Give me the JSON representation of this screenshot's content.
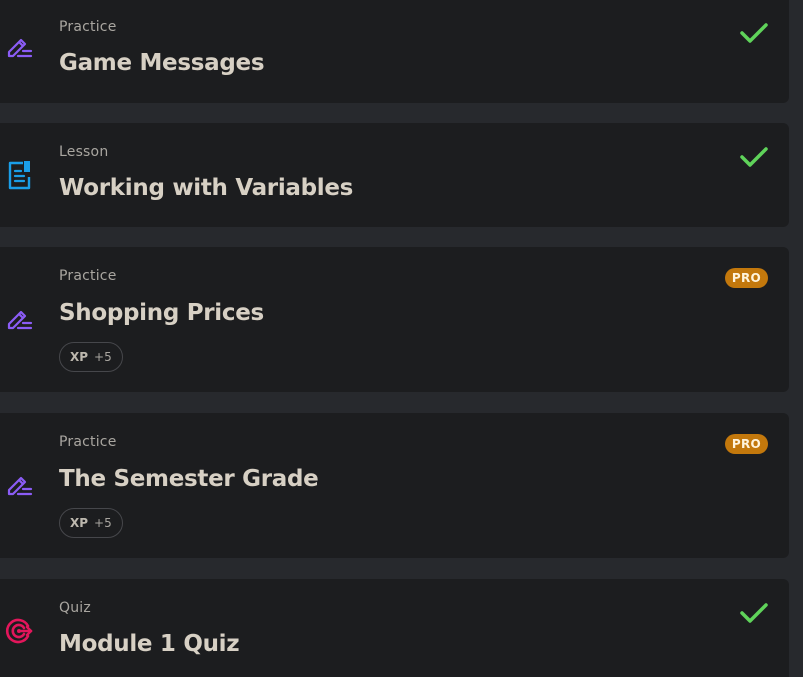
{
  "items": [
    {
      "type": "Practice",
      "title": "Game Messages",
      "status": "completed",
      "icon": "pencil-lines-icon"
    },
    {
      "type": "Lesson",
      "title": "Working with Variables",
      "status": "completed",
      "icon": "document-icon"
    },
    {
      "type": "Practice",
      "title": "Shopping Prices",
      "status": "pro",
      "badge": "PRO",
      "xp_label": "XP",
      "xp_value": "+5",
      "icon": "pencil-lines-icon"
    },
    {
      "type": "Practice",
      "title": "The Semester Grade",
      "status": "pro",
      "badge": "PRO",
      "xp_label": "XP",
      "xp_value": "+5",
      "icon": "pencil-lines-icon"
    },
    {
      "type": "Quiz",
      "title": "Module 1 Quiz",
      "status": "completed",
      "icon": "target-icon"
    }
  ],
  "colors": {
    "background": "#27292d",
    "card": "#1c1d1f",
    "practice_icon": "#8b5cf6",
    "lesson_icon": "#1a9ee8",
    "quiz_icon": "#e3165b",
    "check": "#5fd35a",
    "pro_badge": "#c3780c"
  }
}
